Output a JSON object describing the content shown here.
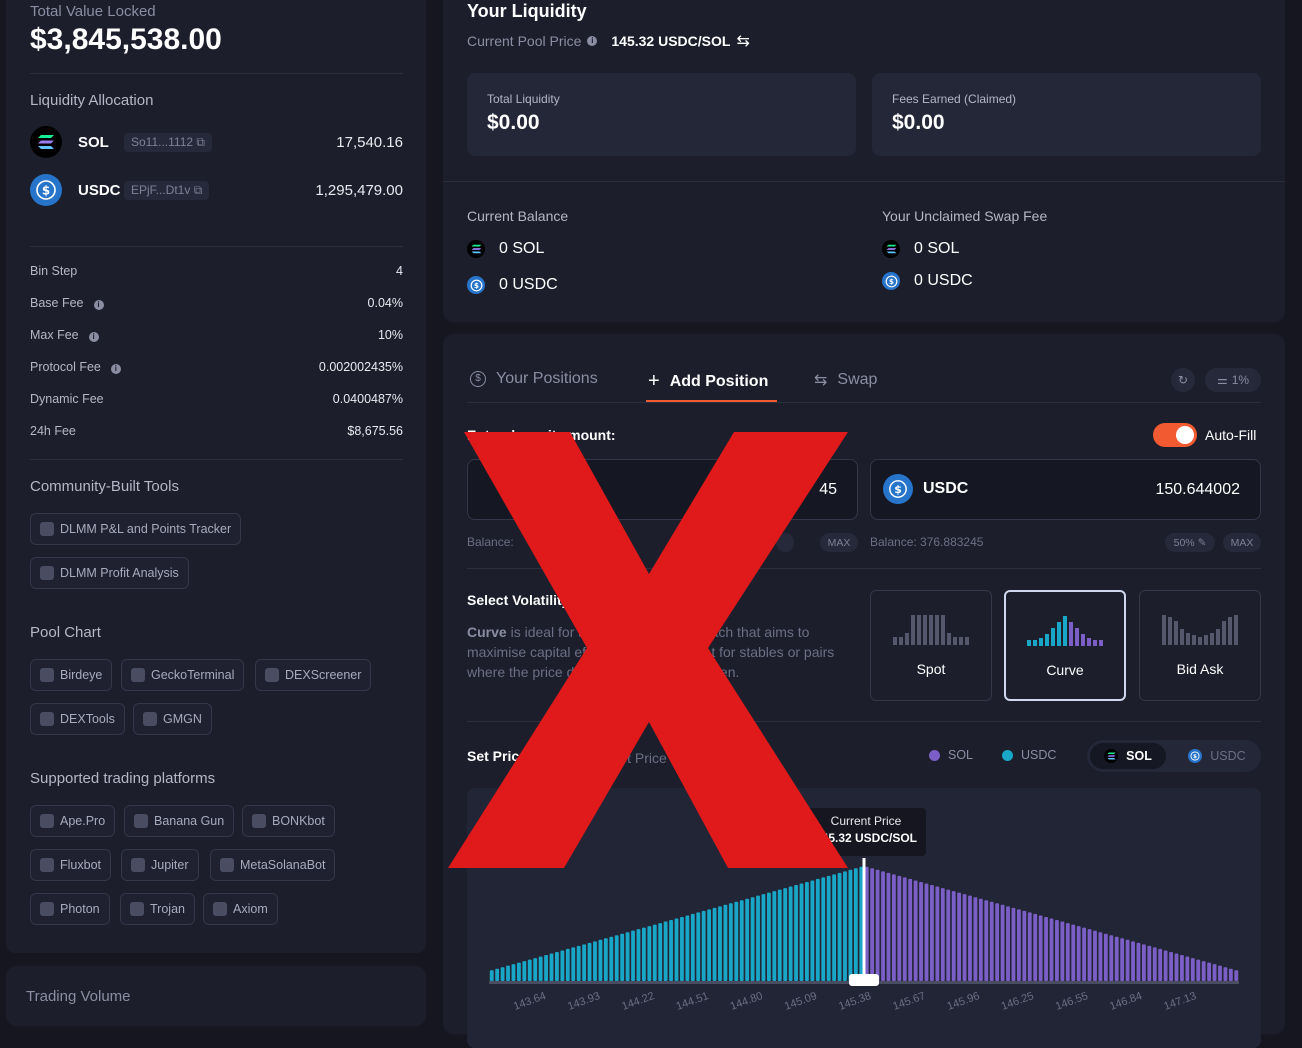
{
  "left": {
    "tvl_label": "Total Value Locked",
    "tvl_value": "$3,845,538.00",
    "alloc_title": "Liquidity Allocation",
    "tokens": [
      {
        "name": "SOL",
        "address": "So11...1112",
        "amount": "17,540.16"
      },
      {
        "name": "USDC",
        "address": "EPjF...Dt1v",
        "amount": "1,295,479.00"
      }
    ],
    "fees": [
      {
        "label": "Bin Step",
        "value": "4"
      },
      {
        "label": "Base Fee",
        "value": "0.04%"
      },
      {
        "label": "Max Fee",
        "value": "10%"
      },
      {
        "label": "Protocol Fee",
        "value": "0.002002435%"
      },
      {
        "label": "Dynamic Fee",
        "value": "0.0400487%"
      },
      {
        "label": "24h Fee",
        "value": "$8,675.56"
      }
    ],
    "community_title": "Community-Built Tools",
    "community_tools": [
      "DLMM P&L and Points Tracker",
      "DLMM Profit Analysis"
    ],
    "pool_chart_title": "Pool Chart",
    "pool_chart_tools": [
      "Birdeye",
      "GeckoTerminal",
      "DEXScreener",
      "DEXTools",
      "GMGN"
    ],
    "platforms_title": "Supported trading platforms",
    "platforms": [
      "Ape.Pro",
      "Banana Gun",
      "BONKbot",
      "Fluxbot",
      "Jupiter",
      "MetaSolanaBot",
      "Photon",
      "Trojan",
      "Axiom"
    ],
    "trading_volume_title": "Trading Volume"
  },
  "liquidity": {
    "title": "Your Liquidity",
    "pool_price_label": "Current Pool Price",
    "pool_price_value": "145.32 USDC/SOL",
    "total_liquidity_label": "Total Liquidity",
    "total_liquidity_value": "$0.00",
    "fees_earned_label": "Fees Earned (Claimed)",
    "fees_earned_value": "$0.00",
    "current_balance_title": "Current Balance",
    "current_balance": [
      "0 SOL",
      "0 USDC"
    ],
    "unclaimed_title": "Your Unclaimed Swap Fee",
    "unclaimed": [
      "0 SOL",
      "0 USDC"
    ]
  },
  "position": {
    "tabs": [
      "Your Positions",
      "Add Position",
      "Swap"
    ],
    "slippage": "1%",
    "enter_title": "Enter deposit amount:",
    "autofill_label": "Auto-Fill",
    "sol_input": {
      "amount": "45",
      "balance": "Balance:"
    },
    "usdc_input": {
      "token": "USDC",
      "amount": "150.644002",
      "balance": "Balance: 376.883245"
    },
    "pill_50": "50%",
    "pill_max": "MAX",
    "volatility_title": "Select Volatility Strategy",
    "volatility_desc_strong": "Curve",
    "volatility_desc": " is ideal for a concentrated approach that aims to maximise capital efficiency. This is great for stables or pairs where the price does not change very often.",
    "strategies": [
      "Spot",
      "Curve",
      "Bid Ask"
    ],
    "set_price_title": "Set Price Range",
    "set_price_alt": "Set Price",
    "legend": [
      "SOL",
      "USDC"
    ],
    "toggle_tokens": [
      "SOL",
      "USDC"
    ],
    "current_price_label": "Current Price",
    "current_price_value": "145.32 USDC/SOL"
  },
  "colors": {
    "accent": "#f25a31",
    "sol_bar": "#7b5fc7",
    "usdc_bar": "#19a7c7",
    "x_mark": "#e0191b"
  },
  "chart_data": {
    "type": "bar",
    "x_tick_labels": [
      "143.64",
      "143.93",
      "144.22",
      "144.51",
      "144.80",
      "145.09",
      "145.38",
      "145.67",
      "145.96",
      "146.25",
      "146.55",
      "146.84",
      "147.13"
    ],
    "current_price": 145.32,
    "series": [
      {
        "name": "USDC",
        "shape": "increasing",
        "bins": 69
      },
      {
        "name": "SOL",
        "shape": "decreasing",
        "bins": 69
      }
    ]
  }
}
